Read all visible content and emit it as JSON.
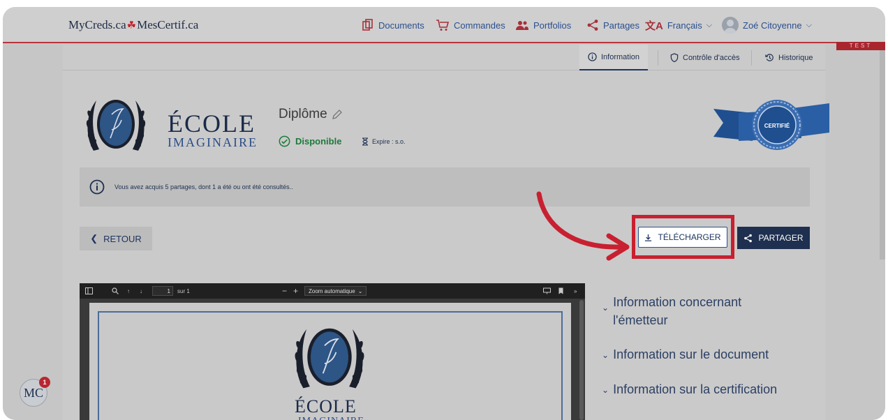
{
  "brand": {
    "left": "MyCreds.ca",
    "leaf": "♣",
    "right": "MesCertif.ca"
  },
  "nav": {
    "documents": "Documents",
    "orders": "Commandes",
    "portfolios": "Portfolios",
    "shares": "Partages",
    "language": "Français",
    "user": "Zoé Citoyenne"
  },
  "env_ribbon": "TEST",
  "tabs": {
    "information": "Information",
    "access_control": "Contrôle d'accès",
    "history": "Historique"
  },
  "credential": {
    "school_name": "ÉCOLE",
    "school_sub": "IMAGINAIRE",
    "title": "Diplôme",
    "status": "Disponible",
    "expire": "Expire : s.o.",
    "badge": "CERTIFIÉ"
  },
  "alert": {
    "message": "Vous avez acquis 5 partages, dont 1 a été ou ont été consultés.."
  },
  "buttons": {
    "back": "RETOUR",
    "download": "TÉLÉCHARGER",
    "share": "PARTAGER"
  },
  "pdf": {
    "page_value": "1",
    "page_total": "sur 1",
    "zoom": "Zoom automatique"
  },
  "accordion": {
    "issuer_line1": "Information concernant",
    "issuer_line2": "l'émetteur",
    "document": "Information sur le document",
    "certification": "Information sur la certification"
  },
  "fab": {
    "label": "MC",
    "badge": "1"
  },
  "colors": {
    "accent_red": "#c82030",
    "navy": "#1e2f4f",
    "link_blue": "#2b4f8f",
    "success_green": "#1d7a3a"
  }
}
